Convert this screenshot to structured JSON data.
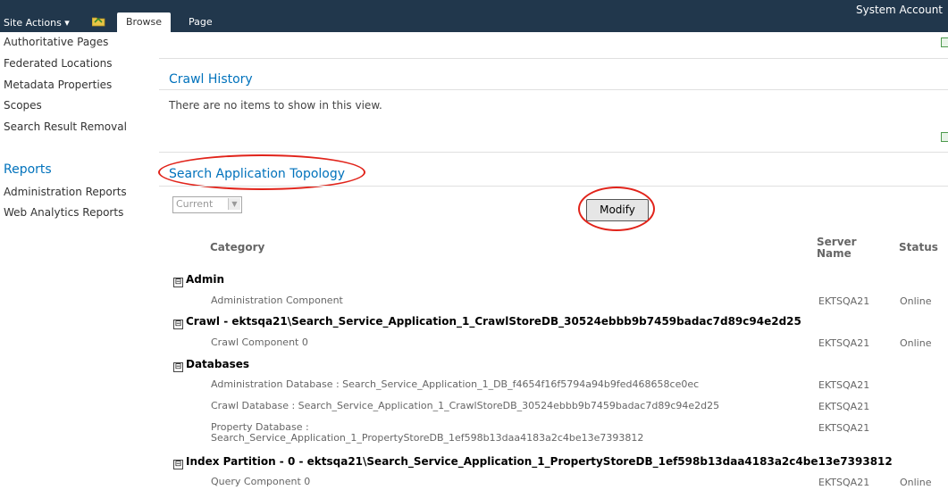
{
  "ribbon": {
    "site_actions": "Site Actions ▾",
    "tabs": [
      "Browse",
      "Page"
    ],
    "account": "System Account"
  },
  "leftnav": {
    "items": [
      "Authoritative Pages",
      "Federated Locations",
      "Metadata Properties",
      "Scopes",
      "Search Result Removal"
    ],
    "reports_heading": "Reports",
    "reports_items": [
      "Administration Reports",
      "Web Analytics Reports"
    ]
  },
  "crawl_history": {
    "title": "Crawl History",
    "empty_message": "There are no items to show in this view."
  },
  "topology": {
    "title": "Search Application Topology",
    "view_select": "Current",
    "modify_button": "Modify",
    "columns": {
      "category": "Category",
      "server_name_1": "Server",
      "server_name_2": "Name",
      "status": "Status"
    },
    "groups": [
      {
        "toggle": "⊟",
        "label": "Admin"
      },
      {
        "toggle": "⊟",
        "label": "Crawl - ektsqa21\\Search_Service_Application_1_CrawlStoreDB_30524ebbb9b7459badac7d89c94e2d25"
      },
      {
        "toggle": "⊟",
        "label": "Databases"
      },
      {
        "toggle": "⊟",
        "label": "Index Partition - 0 - ektsqa21\\Search_Service_Application_1_PropertyStoreDB_1ef598b13daa4183a2c4be13e7393812"
      }
    ],
    "rows": [
      {
        "name": "Administration Component",
        "server": "EKTSQA21",
        "status": "Online"
      },
      {
        "name": "Crawl Component 0",
        "server": "EKTSQA21",
        "status": "Online"
      },
      {
        "name": "Administration Database : Search_Service_Application_1_DB_f4654f16f5794a94b9fed468658ce0ec",
        "server": "EKTSQA21",
        "status": ""
      },
      {
        "name": "Crawl Database : Search_Service_Application_1_CrawlStoreDB_30524ebbb9b7459badac7d89c94e2d25",
        "server": "EKTSQA21",
        "status": ""
      },
      {
        "name_line1": "Property Database :",
        "name_line2": "Search_Service_Application_1_PropertyStoreDB_1ef598b13daa4183a2c4be13e7393812",
        "server": "EKTSQA21",
        "status": ""
      },
      {
        "name": "Query Component 0",
        "server": "EKTSQA21",
        "status": "Online"
      }
    ]
  }
}
